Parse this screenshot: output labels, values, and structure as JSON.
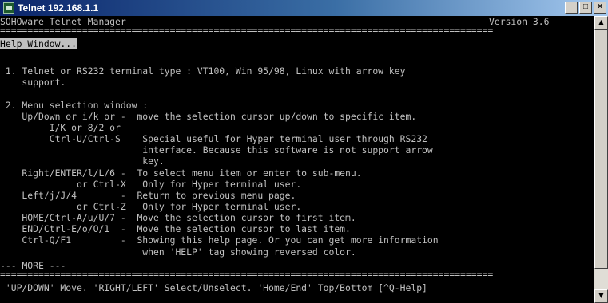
{
  "window": {
    "title": "Telnet 192.168.1.1",
    "minimize": "_",
    "maximize": "□",
    "close": "×",
    "icon": "telnet-app-icon"
  },
  "header": {
    "app_name": "SOHOware Telnet Manager",
    "version": "Version 3.6",
    "separator": "=========================================================================================="
  },
  "help": {
    "label": "Help Window...",
    "lines": [
      "",
      " 1. Telnet or RS232 terminal type : VT100, Win 95/98, Linux with arrow key",
      "    support.",
      "",
      " 2. Menu selection window :",
      "    Up/Down or i/k or -  move the selection cursor up/down to specific item.",
      "         I/K or 8/2 or",
      "         Ctrl-U/Ctrl-S    Special useful for Hyper terminal user through RS232",
      "                          interface. Because this software is not support arrow",
      "                          key.",
      "    Right/ENTER/l/L/6 -  To select menu item or enter to sub-menu.",
      "              or Ctrl-X   Only for Hyper terminal user.",
      "    Left/j/J/4        -  Return to previous menu page.",
      "              or Ctrl-Z   Only for Hyper terminal user.",
      "    HOME/Ctrl-A/u/U/7 -  Move the selection cursor to first item.",
      "    END/Ctrl-E/o/O/1  -  Move the selection cursor to last item.",
      "    Ctrl-Q/F1         -  Showing this help page. Or you can get more information",
      "                          when 'HELP' tag showing reversed color."
    ],
    "more_prefix": "--- ",
    "more_label": "MORE",
    "more_suffix": " ---",
    "footer_separator": "=========================================================================================="
  },
  "status_bar": {
    "text": " 'UP/DOWN' Move. 'RIGHT/LEFT' Select/Unselect. 'Home/End' Top/Bottom [^Q-Help]"
  },
  "scrollbar": {
    "up_glyph": "▲",
    "down_glyph": "▼"
  }
}
